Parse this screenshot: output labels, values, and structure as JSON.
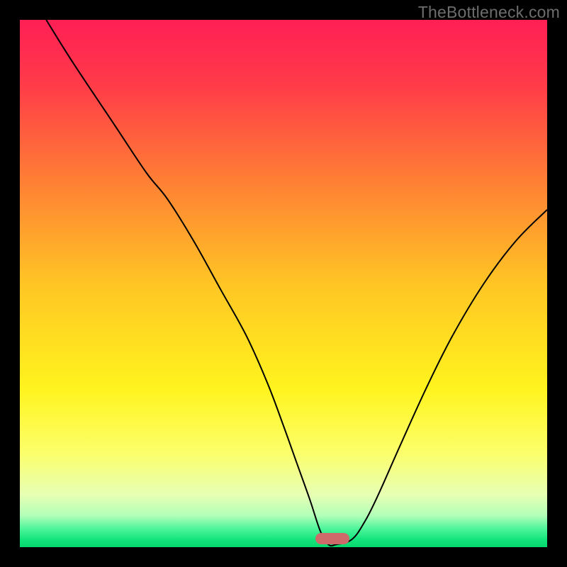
{
  "watermark": "TheBottleneck.com",
  "chart_data": {
    "type": "line",
    "title": "",
    "xlabel": "",
    "ylabel": "",
    "xlim": [
      0,
      100
    ],
    "ylim": [
      0,
      100
    ],
    "grid": false,
    "legend": false,
    "background_gradient_stops": [
      {
        "pos": 0.0,
        "color": "#ff1f55"
      },
      {
        "pos": 0.12,
        "color": "#ff3a49"
      },
      {
        "pos": 0.3,
        "color": "#ff7d35"
      },
      {
        "pos": 0.5,
        "color": "#ffc524"
      },
      {
        "pos": 0.7,
        "color": "#fff41e"
      },
      {
        "pos": 0.82,
        "color": "#fcff6a"
      },
      {
        "pos": 0.9,
        "color": "#e7ffb3"
      },
      {
        "pos": 0.94,
        "color": "#b3ffb8"
      },
      {
        "pos": 0.965,
        "color": "#4ef59b"
      },
      {
        "pos": 0.985,
        "color": "#14e57e"
      },
      {
        "pos": 1.0,
        "color": "#06d86d"
      }
    ],
    "series": [
      {
        "name": "bottleneck-curve",
        "color": "#000000",
        "stroke_width": 2,
        "x": [
          5.0,
          10.0,
          18.0,
          24.0,
          28.0,
          33.0,
          38.0,
          43.0,
          47.0,
          50.0,
          52.5,
          55.0,
          57.0,
          58.5,
          60.0,
          63.0,
          65.5,
          68.0,
          72.0,
          77.0,
          82.0,
          88.0,
          94.0,
          100.0
        ],
        "values": [
          100.0,
          92.0,
          80.0,
          71.0,
          66.0,
          58.0,
          49.0,
          40.0,
          31.0,
          23.0,
          16.0,
          9.0,
          3.0,
          0.5,
          0.5,
          1.5,
          5.0,
          10.0,
          19.0,
          30.0,
          40.0,
          50.0,
          58.0,
          64.0
        ]
      }
    ],
    "marker": {
      "name": "optimum-marker",
      "color": "#cf6a6a",
      "x_center": 59.3,
      "width_pct": 6.4,
      "y_bottom_pct": 0.5,
      "height_pct": 2.2
    }
  }
}
